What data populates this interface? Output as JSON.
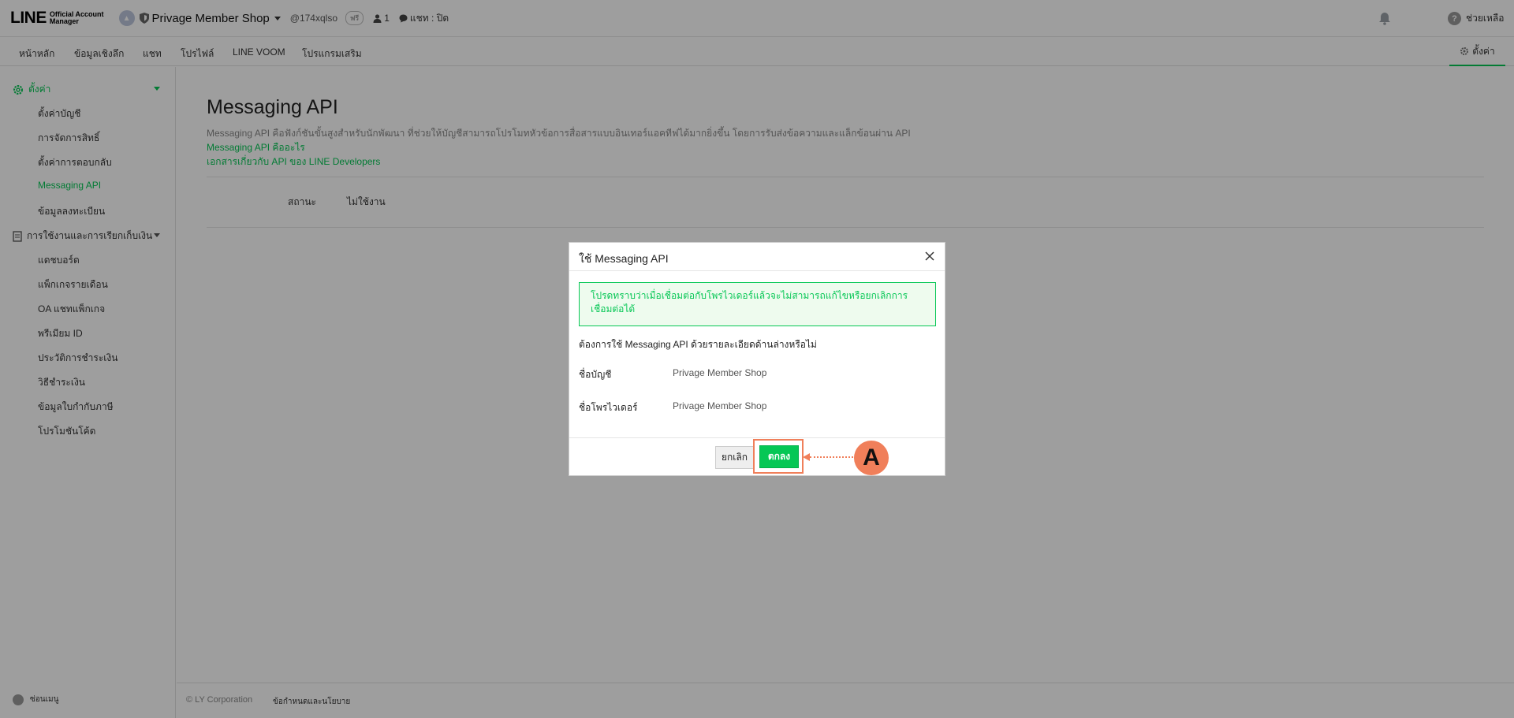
{
  "header": {
    "logo_main": "LINE",
    "logo_sub_1": "Official Account",
    "logo_sub_2": "Manager",
    "account_name": "Privage Member Shop",
    "account_id": "@174xqlso",
    "plan_badge": "ฟรี",
    "friend_count": "1",
    "chat_status": "แชท : ปิด",
    "help_label": "ช่วยเหลือ"
  },
  "nav": {
    "items": [
      "หน้าหลัก",
      "ข้อมูลเชิงลึก",
      "แชท",
      "โปรไฟล์",
      "LINE VOOM",
      "โปรแกรมเสริม"
    ],
    "settings_label": "ตั้งค่า"
  },
  "sidebar": {
    "group_settings": "ตั้งค่า",
    "settings_items": [
      "ตั้งค่าบัญชี",
      "การจัดการสิทธิ์",
      "ตั้งค่าการตอบกลับ",
      "Messaging API",
      "ข้อมูลลงทะเบียน"
    ],
    "active_item": "Messaging API",
    "group_billing": "การใช้งานและการเรียกเก็บเงิน",
    "billing_items": [
      "แดชบอร์ด",
      "แพ็กเกจรายเดือน",
      "OA แชทแพ็กเกจ",
      "พรีเมียม ID",
      "ประวัติการชำระเงิน",
      "วิธีชำระเงิน",
      "ข้อมูลใบกำกับภาษี",
      "โปรโมชันโค้ด"
    ],
    "footer_label": "ซ่อนเมนู"
  },
  "main": {
    "title": "Messaging API",
    "description": "Messaging API คือฟังก์ชันขั้นสูงสำหรับนักพัฒนา ที่ช่วยให้บัญชีสามารถโปรโมทหัวข้อการสื่อสารแบบอินเทอร์แอคทีฟได้มากยิ่งขึ้น โดยการรับส่งข้อความและแล็กข้อนผ่าน API",
    "link_what": "Messaging API คืออะไร",
    "link_docs": "เอกสารเกี่ยวกับ API ของ LINE Developers",
    "status_label": "สถานะ",
    "status_value": "ไม่ใช้งาน"
  },
  "footer": {
    "copyright": "© LY Corporation",
    "terms": "ข้อกำหนดและนโยบาย"
  },
  "modal": {
    "title": "ใช้ Messaging API",
    "notice": "โปรดทราบว่าเมื่อเชื่อมต่อกับโพรไวเดอร์แล้วจะไม่สามารถแก้ไขหรือยกเลิกการเชื่อมต่อได้",
    "question": "ต้องการใช้ Messaging API ด้วยรายละเอียดด้านล่างหรือไม่",
    "account_label": "ชื่อบัญชี",
    "account_value": "Privage Member Shop",
    "provider_label": "ชื่อโพรไวเดอร์",
    "provider_value": "Privage Member Shop",
    "cancel_label": "ยกเลิก",
    "ok_label": "ตกลง"
  },
  "annotation": {
    "badge": "A",
    "color": "#f07f5a"
  },
  "colors": {
    "accent": "#06c755"
  }
}
